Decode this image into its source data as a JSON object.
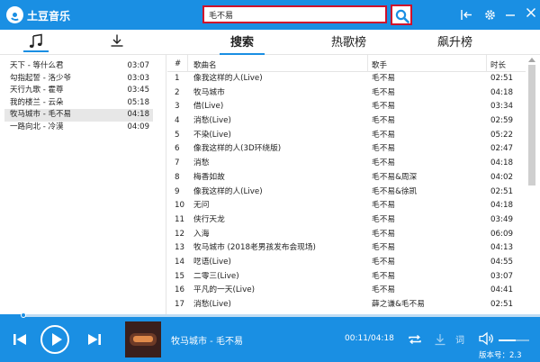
{
  "app": {
    "title": "土豆音乐"
  },
  "search": {
    "query": "毛不易"
  },
  "sidebar_tabs": {
    "music": "music-note-icon",
    "download": "download-icon"
  },
  "tabs": [
    "搜索",
    "热歌榜",
    "飙升榜"
  ],
  "playlist": [
    {
      "title": "天下 - 等什么君",
      "duration": "03:07",
      "active": false
    },
    {
      "title": "勾指起誓 - 洛少爷",
      "duration": "03:03",
      "active": false
    },
    {
      "title": "天行九歌 - 霍尊",
      "duration": "03:45",
      "active": false
    },
    {
      "title": "我的楼兰 - 云朵",
      "duration": "05:18",
      "active": false
    },
    {
      "title": "牧马城市 - 毛不易",
      "duration": "04:18",
      "active": true
    },
    {
      "title": "一路向北 - 冷漠",
      "duration": "04:09",
      "active": false
    }
  ],
  "table": {
    "headers": {
      "num": "#",
      "title": "歌曲名",
      "artist": "歌手",
      "duration": "时长"
    },
    "rows": [
      {
        "num": "1",
        "title": "像我这样的人(Live)",
        "artist": "毛不易",
        "duration": "02:51"
      },
      {
        "num": "2",
        "title": "牧马城市",
        "artist": "毛不易",
        "duration": "04:18"
      },
      {
        "num": "3",
        "title": "借(Live)",
        "artist": "毛不易",
        "duration": "03:34"
      },
      {
        "num": "4",
        "title": "消愁(Live)",
        "artist": "毛不易",
        "duration": "02:59"
      },
      {
        "num": "5",
        "title": "不染(Live)",
        "artist": "毛不易",
        "duration": "05:22"
      },
      {
        "num": "6",
        "title": "像我这样的人(3D环绕版)",
        "artist": "毛不易",
        "duration": "02:47"
      },
      {
        "num": "7",
        "title": "消愁",
        "artist": "毛不易",
        "duration": "04:18"
      },
      {
        "num": "8",
        "title": "梅香如故",
        "artist": "毛不易&周深",
        "duration": "04:02"
      },
      {
        "num": "9",
        "title": "像我这样的人(Live)",
        "artist": "毛不易&徐凯",
        "duration": "02:51"
      },
      {
        "num": "10",
        "title": "无问",
        "artist": "毛不易",
        "duration": "04:18"
      },
      {
        "num": "11",
        "title": "侠行天龙",
        "artist": "毛不易",
        "duration": "03:49"
      },
      {
        "num": "12",
        "title": "入海",
        "artist": "毛不易",
        "duration": "06:09"
      },
      {
        "num": "13",
        "title": "牧马城市 (2018老男孩发布会现场)",
        "artist": "毛不易",
        "duration": "04:13"
      },
      {
        "num": "14",
        "title": "呓语(Live)",
        "artist": "毛不易",
        "duration": "04:55"
      },
      {
        "num": "15",
        "title": "二零三(Live)",
        "artist": "毛不易",
        "duration": "03:07"
      },
      {
        "num": "16",
        "title": "平凡的一天(Live)",
        "artist": "毛不易",
        "duration": "04:41"
      },
      {
        "num": "17",
        "title": "消愁(Live)",
        "artist": "薛之谦&毛不易",
        "duration": "02:51"
      }
    ]
  },
  "player": {
    "now_playing": "牧马城市 - 毛不易",
    "time": "00:11/04:18",
    "progress_fraction": 0.043,
    "volume_fraction": 0.55,
    "lyric_label": "词",
    "version": "版本号：2.3"
  },
  "colors": {
    "accent": "#1a8fe3",
    "highlight_border": "#d0102b",
    "active_row": "#e7e7e7"
  }
}
